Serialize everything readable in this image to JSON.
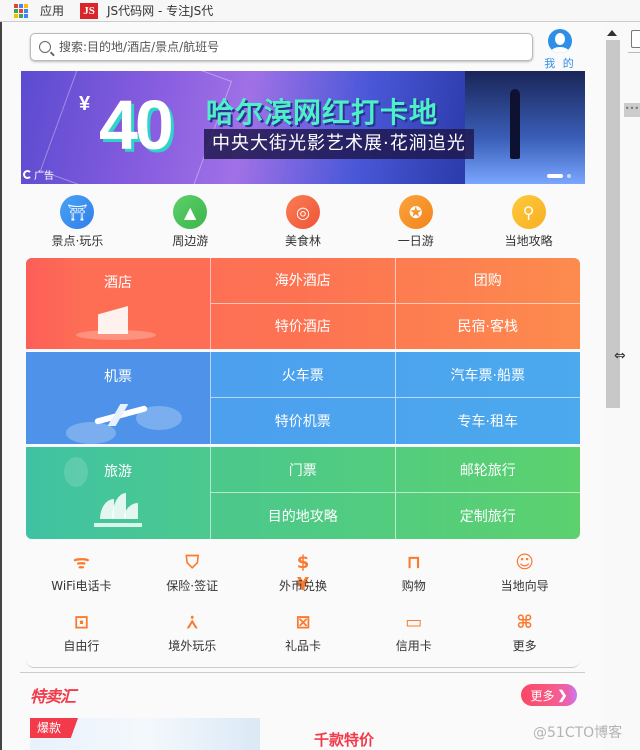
{
  "bookmarks": {
    "apps_label": "应用",
    "site_badge": "JS",
    "site_label": "JS代码网 - 专注JS代"
  },
  "search": {
    "placeholder": "搜索:目的地/酒店/景点/航班号",
    "value": ""
  },
  "profile": {
    "label": "我 的",
    "icon": "user-icon",
    "color": "#2f8fe8"
  },
  "banner": {
    "currency": "¥",
    "price": "40",
    "title": "哈尔滨网红打卡地",
    "subtitle": "中央大街光影艺术展·花涧追光",
    "ad_label": "广告",
    "slide_count": 2,
    "active_slide": 1
  },
  "quick_nav": [
    {
      "label": "景点·玩乐",
      "icon": "pavilion-icon",
      "color": "#3d8ff0"
    },
    {
      "label": "周边游",
      "icon": "mountain-icon",
      "color": "#4cc459"
    },
    {
      "label": "美食林",
      "icon": "food-badge-icon",
      "color": "#f66a45"
    },
    {
      "label": "一日游",
      "icon": "ferris-wheel-icon",
      "color": "#f7962a"
    },
    {
      "label": "当地攻略",
      "icon": "map-pin-icon",
      "color": "#fbbe2a"
    }
  ],
  "grid": {
    "hotel": {
      "label": "酒店",
      "items": [
        "海外酒店",
        "团购",
        "特价酒店",
        "民宿·客栈"
      ]
    },
    "flight": {
      "label": "机票",
      "items": [
        "火车票",
        "汽车票·船票",
        "特价机票",
        "专车·租车"
      ]
    },
    "travel": {
      "label": "旅游",
      "items": [
        "门票",
        "邮轮旅行",
        "目的地攻略",
        "定制旅行"
      ]
    }
  },
  "services": [
    [
      {
        "label": "WiFi电话卡",
        "icon": "wifi-icon"
      },
      {
        "label": "保险·签证",
        "icon": "shield-icon"
      },
      {
        "label": "外币兑换",
        "icon": "currency-exchange-icon"
      },
      {
        "label": "购物",
        "icon": "shopping-bag-icon"
      },
      {
        "label": "当地向导",
        "icon": "guide-hat-icon"
      }
    ],
    [
      {
        "label": "自由行",
        "icon": "backpack-icon"
      },
      {
        "label": "境外玩乐",
        "icon": "eiffel-tower-icon"
      },
      {
        "label": "礼品卡",
        "icon": "gift-card-icon"
      },
      {
        "label": "信用卡",
        "icon": "credit-card-icon"
      },
      {
        "label": "更多",
        "icon": "more-grid-icon"
      }
    ]
  ],
  "sale": {
    "heading": "特卖汇",
    "more_label": "更多",
    "hot_tag": "爆款",
    "deal_title": "千款特价"
  },
  "watermark": "@51CTO博客",
  "colors": {
    "hotel": "#fd6e55",
    "flight": "#4e9cee",
    "travel": "#4cc98e",
    "service_icon": "#fb7a2e",
    "sale_red": "#f23a4a"
  }
}
